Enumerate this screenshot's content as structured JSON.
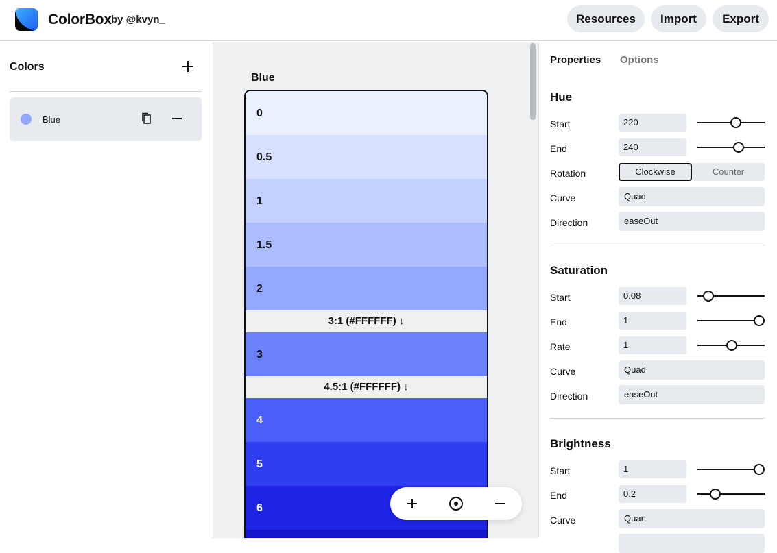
{
  "header": {
    "title": "ColorBox",
    "byline": "by @kvyn_",
    "buttons": {
      "resources": "Resources",
      "import": "Import",
      "export": "Export"
    }
  },
  "sidebar": {
    "title": "Colors",
    "items": [
      {
        "name": "Blue",
        "color": "#93a8ff"
      }
    ]
  },
  "canvas": {
    "scale_title": "Blue",
    "swatches": [
      {
        "label": "0",
        "color": "#ebf0ff",
        "text_color": "#111111"
      },
      {
        "label": "0.5",
        "color": "#d7e1ff",
        "text_color": "#111111"
      },
      {
        "label": "1",
        "color": "#c2d1ff",
        "text_color": "#111111"
      },
      {
        "label": "1.5",
        "color": "#acbeff",
        "text_color": "#111111"
      },
      {
        "label": "2",
        "color": "#94a8ff",
        "text_color": "#111111"
      },
      {
        "contrast": "3:1 (#FFFFFF) ↓"
      },
      {
        "label": "3",
        "color": "#6b80fb",
        "text_color": "#111111"
      },
      {
        "contrast": "4.5:1 (#FFFFFF) ↓"
      },
      {
        "label": "4",
        "color": "#4a5ff7",
        "text_color": "#ffffff"
      },
      {
        "label": "5",
        "color": "#2e3ef0",
        "text_color": "#ffffff"
      },
      {
        "label": "6",
        "color": "#1d24e4",
        "text_color": "#ffffff"
      },
      {
        "label": "",
        "color": "#1515cc",
        "text_color": "#ffffff"
      }
    ]
  },
  "panel": {
    "tabs": {
      "properties": "Properties",
      "options": "Options"
    },
    "labels": {
      "start": "Start",
      "end": "End",
      "rotation": "Rotation",
      "curve": "Curve",
      "direction": "Direction",
      "rate": "Rate"
    },
    "hue": {
      "title": "Hue",
      "start": "220",
      "end": "240",
      "start_level": 0.58,
      "end_level": 0.63,
      "rotation_on": "Clockwise",
      "rotation_off": "Counter",
      "curve": "Quad",
      "direction": "easeOut"
    },
    "saturation": {
      "title": "Saturation",
      "start": "0.08",
      "end": "1",
      "rate": "1",
      "start_level": 0.08,
      "end_level": 1,
      "rate_level": 0.5,
      "curve": "Quad",
      "direction": "easeOut"
    },
    "brightness": {
      "title": "Brightness",
      "start": "1",
      "end": "0.2",
      "start_level": 1,
      "end_level": 0.2,
      "curve": "Quart"
    }
  }
}
